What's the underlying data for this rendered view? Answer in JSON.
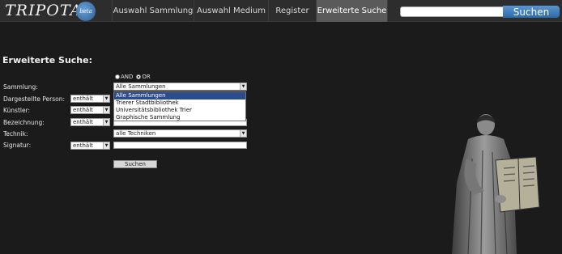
{
  "header": {
    "logo_text": "TRIPOTA",
    "logo_badge": "beta",
    "nav": [
      "Auswahl Sammlung",
      "Auswahl Medium",
      "Register",
      "Erweiterte Suche"
    ],
    "search_button": "Suchen",
    "search_placeholder": ""
  },
  "form": {
    "title": "Erweiterte Suche:",
    "logic": {
      "and_label": "AND",
      "or_label": "OR",
      "selected": "OR"
    },
    "labels": {
      "sammlung": "Sammlung:",
      "dargestellte_person": "Dargestellte Person:",
      "kuenstler": "Künstler:",
      "bezeichnung": "Bezeichnung:",
      "technik": "Technik:",
      "signatur": "Signatur:"
    },
    "operator_value": "enthält",
    "sammlung_value": "Alle Sammlungen",
    "sammlung_options": [
      "Alle Sammlungen",
      "Trierer Stadtbibliothek",
      "Universitätsbibliothek Trier",
      "Graphische Sammlung"
    ],
    "technik_value": "alle Techniken",
    "submit_label": "Suchen"
  }
}
